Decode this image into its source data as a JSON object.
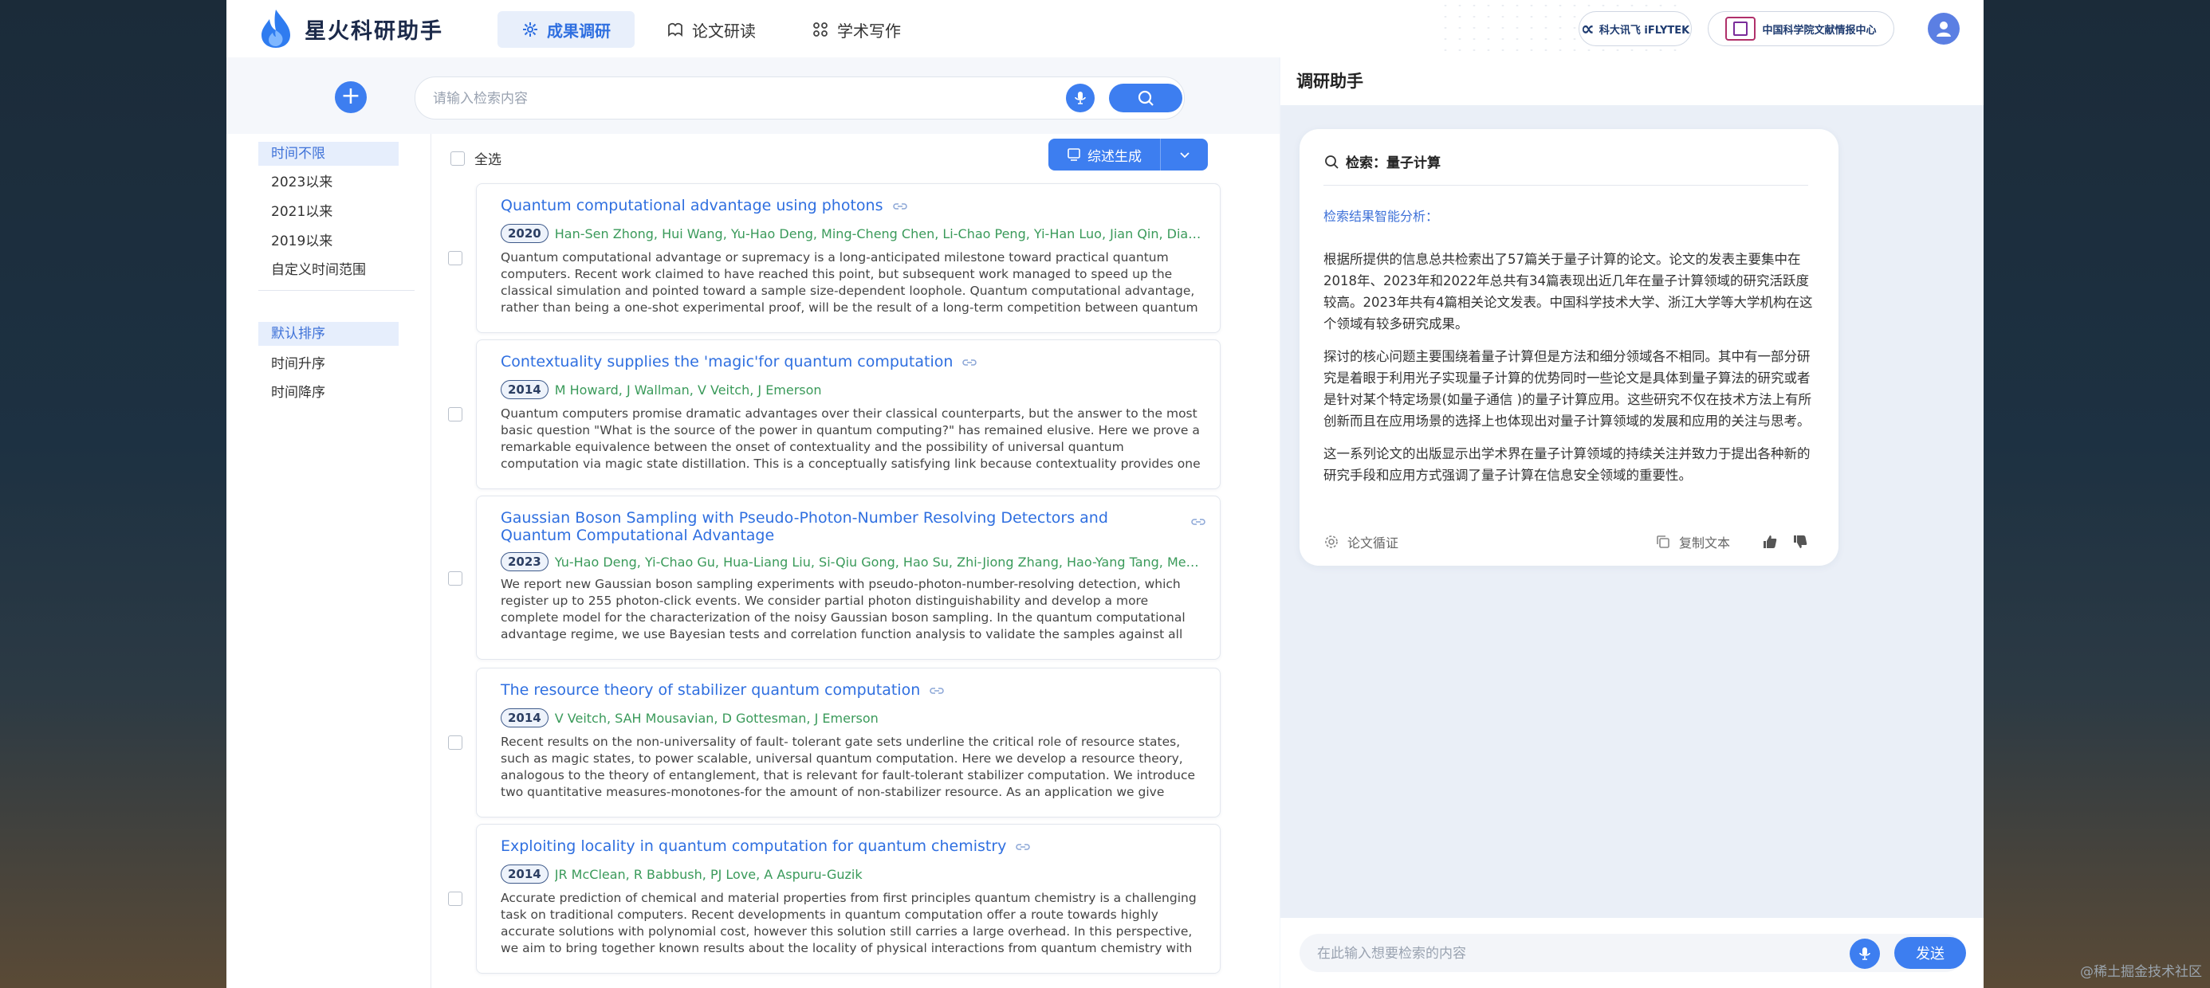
{
  "app": {
    "name": "星火科研助手"
  },
  "nav": {
    "tabs": [
      {
        "label": "成果调研",
        "icon": "chart-icon",
        "active": true
      },
      {
        "label": "论文研读",
        "icon": "book-icon",
        "active": false
      },
      {
        "label": "学术写作",
        "icon": "grid-icon",
        "active": false
      }
    ]
  },
  "partners": {
    "p1_mark": "∝",
    "p1_text": "科大讯飞 iFLYTEK",
    "p2_text": "中国科学院文献情报中心"
  },
  "search": {
    "placeholder": "请输入检索内容"
  },
  "filters": {
    "time": [
      "时间不限",
      "2023以来",
      "2021以来",
      "2019以来",
      "自定义时间范围"
    ],
    "sort": [
      "默认排序",
      "时间升序",
      "时间降序"
    ]
  },
  "results": {
    "select_all_label": "全选",
    "generate_label": "综述生成",
    "papers": [
      {
        "title": "Quantum computational advantage using photons",
        "year": "2020",
        "authors": "Han-Sen Zhong, Hui Wang, Yu-Hao Deng, Ming-Cheng Chen, Li-Chao Peng, Yi-Han Luo, Jian Qin, Dian Wu...",
        "abstract": "Quantum computational advantage or supremacy is a long-anticipated milestone toward practical quantum computers. Recent work claimed to have reached this point, but subsequent work managed to speed up the classical simulation and pointed toward a sample size-dependent loophole. Quantum computational advantage, rather than being a one-shot experimental proof, will be the result of a long-term competition between quantum devices and..."
      },
      {
        "title": "Contextuality supplies the 'magic'for quantum computation",
        "year": "2014",
        "authors": "M Howard, J Wallman, V Veitch, J Emerson",
        "abstract": "Quantum computers promise dramatic advantages over their classical counterparts, but the answer to the most basic question \"What is the source of the power in quantum computing?\" has remained elusive. Here we prove a remarkable equivalence between the onset of contextuality and the possibility of universal quantum computation via magic state distillation. This is a conceptually satisfying link because contextuality provides one of the fundamental..."
      },
      {
        "title": "Gaussian Boson Sampling with Pseudo-Photon-Number Resolving Detectors and Quantum Computational Advantage",
        "year": "2023",
        "authors": "Yu-Hao Deng, Yi-Chao Gu, Hua-Liang Liu, Si-Qiu Gong, Hao Su, Zhi-Jiong Zhang, Hao-Yang Tang, Meng-H...",
        "abstract": "We report new Gaussian boson sampling experiments with pseudo-photon-number-resolving detection, which register up to 255 photon-click events. We consider partial photon distinguishability and develop a more complete model for the characterization of the noisy Gaussian boson sampling. In the quantum computational advantage regime, we use Bayesian tests and correlation function analysis to validate the samples against all current classical..."
      },
      {
        "title": "The resource theory of stabilizer quantum computation",
        "year": "2014",
        "authors": "V Veitch, SAH Mousavian, D Gottesman, J Emerson",
        "abstract": "Recent results on the non-universality of fault- tolerant gate sets underline the critical role of resource states, such as magic states, to power scalable, universal quantum computation. Here we develop a resource theory, analogous to the theory of entanglement, that is relevant for fault-tolerant stabilizer computation. We introduce two quantitative measures-monotones-for the amount of non-stabilizer resource. As an application we give absolute bounds on the..."
      },
      {
        "title": "Exploiting locality in quantum computation for quantum chemistry",
        "year": "2014",
        "authors": "JR McClean, R Babbush, PJ Love, A Aspuru-Guzik",
        "abstract": "Accurate prediction of chemical and material properties from first principles quantum chemistry is a challenging task on traditional computers. Recent developments in quantum computation offer a route towards highly accurate solutions with polynomial cost, however this solution still carries a large overhead. In this perspective, we aim to bring together known results about the locality of physical interactions from quantum chemistry with ideas from..."
      }
    ]
  },
  "assistant": {
    "title": "调研助手",
    "query_label": "检索：量子计算",
    "analysis_label": "检索结果智能分析：",
    "paragraphs": [
      "根据所提供的信息总共检索出了57篇关于量子计算的论文。论文的发表主要集中在2018年、2023年和2022年总共有34篇表现出近几年在量子计算领域的研究活跃度较高。2023年共有4篇相关论文发表。中国科学技术大学、浙江大学等大学机构在这个领域有较多研究成果。",
      "探讨的核心问题主要围绕着量子计算但是方法和细分领域各不相同。其中有一部分研究是着眼于利用光子实现量子计算的优势同时一些论文是具体到量子算法的研究或者是针对某个特定场景(如量子通信 )的量子计算应用。这些研究不仅在技术方法上有所创新而且在应用场景的选择上也体现出对量子计算领域的发展和应用的关注与思考。",
      "这一系列论文的出版显示出学术界在量子计算领域的持续关注并致力于提出各种新的研究手段和应用方式强调了量子计算在信息安全领域的重要性。"
    ],
    "verify_label": "论文循证",
    "copy_label": "复制文本",
    "chat_placeholder": "在此输入想要检索的内容",
    "send_label": "发送"
  },
  "watermark": "@稀土掘金技术社区"
}
